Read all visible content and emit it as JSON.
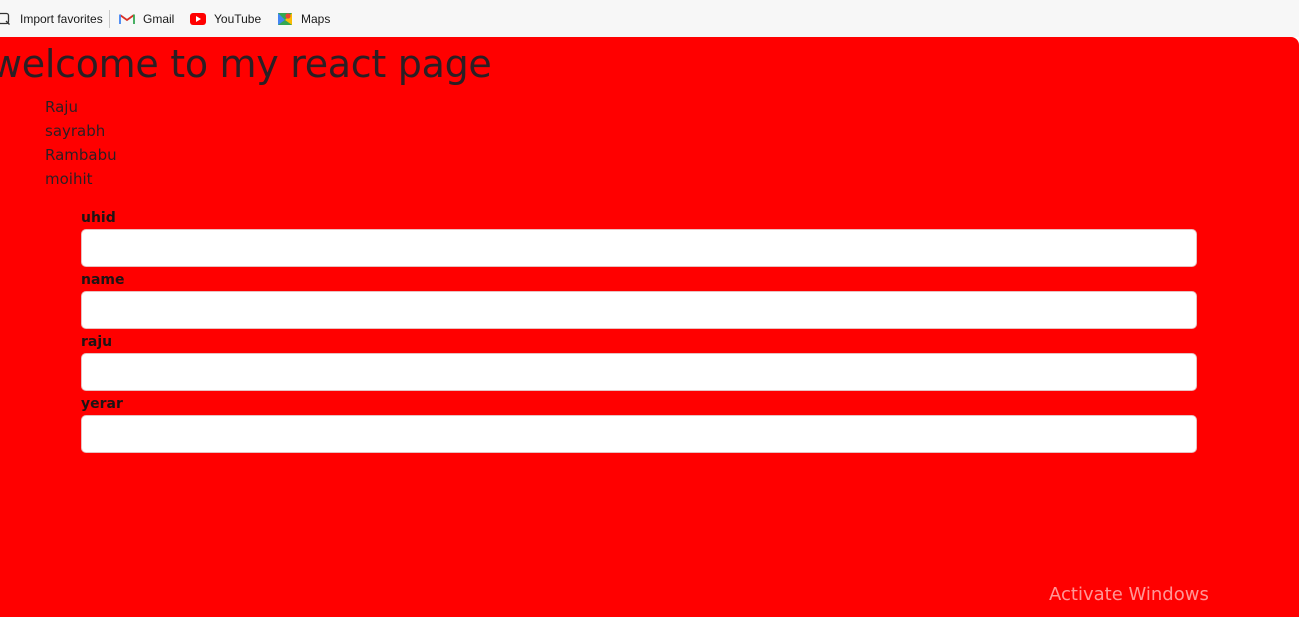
{
  "bookmarks": {
    "import_favorites": "Import favorites",
    "gmail": "Gmail",
    "youtube": "YouTube",
    "maps": "Maps",
    "icons": [
      "import-favorites-icon",
      "gmail-icon",
      "youtube-icon",
      "maps-icon"
    ]
  },
  "page": {
    "background_color": "#ff0000",
    "title": "welcome to my react page",
    "names": [
      "Raju",
      "sayrabh",
      "Rambabu",
      "moihit"
    ]
  },
  "form": {
    "fields": [
      {
        "label": "uhid",
        "value": ""
      },
      {
        "label": "name",
        "value": ""
      },
      {
        "label": "raju",
        "value": ""
      },
      {
        "label": "yerar",
        "value": ""
      }
    ]
  },
  "overlay": {
    "watermark": "Activate Windows"
  }
}
